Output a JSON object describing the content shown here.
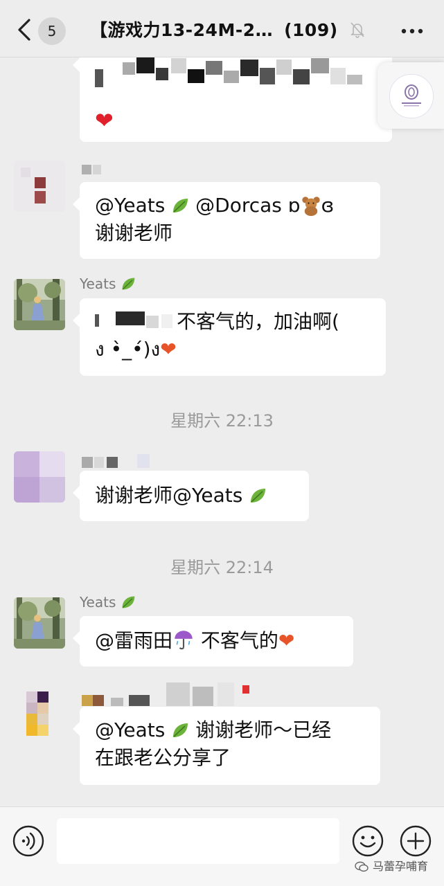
{
  "header": {
    "unread_count": "5",
    "title": "【游戏力13-24M-2…",
    "member_count": "(109)"
  },
  "messages": [
    {
      "sender": "",
      "text_end": ""
    },
    {
      "sender": "",
      "mentions": [
        "@Yeats",
        "@Dorcas ɒ",
        "ɞ"
      ],
      "text_line2": "谢谢老师"
    },
    {
      "sender": "Yeats",
      "text_a": "不客气的，加油啊(",
      "text_b": "ง •̀_•́)ง"
    },
    {
      "timestamp": "星期六 22:13"
    },
    {
      "sender": "",
      "text_a": "谢谢老师@Yeats"
    },
    {
      "timestamp": "星期六 22:14"
    },
    {
      "sender": "Yeats",
      "text_a": "@雷雨田",
      "text_b": " 不客气的"
    },
    {
      "sender": "",
      "text_a": "@Yeats",
      "text_b": " 谢谢老师～已经",
      "text_line2": "在跟老公分享了"
    }
  ],
  "watermark": "马蕾孕哺育",
  "colors": {
    "background": "#ededed",
    "bubble": "#ffffff",
    "timestamp": "#9a9a9a",
    "heart": "#e8542a"
  },
  "icons": [
    "back-arrow-icon",
    "mute-bell-icon",
    "more-dots-icon",
    "leaf-emoji-icon",
    "heart-emoji-icon",
    "umbrella-emoji-icon",
    "teddy-bear-emoji-icon",
    "voice-icon",
    "emoji-face-icon",
    "plus-icon"
  ]
}
